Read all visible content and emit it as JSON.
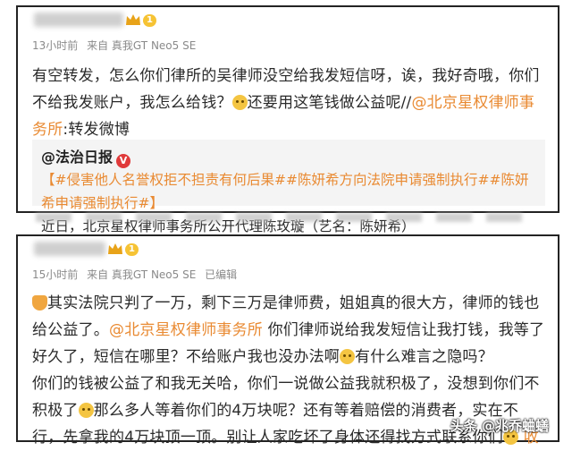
{
  "post1": {
    "level": "1",
    "meta": {
      "time": "13小时前",
      "source": "来自 真我GT Neo5 SE"
    },
    "text_a": "有空转发，怎么你们律所的吴律师没空给我发短信呀，诶，我好奇哦，你们不给我发账户，我怎么给钱？",
    "text_b": "还要用这笔钱做公益呢//",
    "mention": "@北京星权律师事务所",
    "text_c": ":转发微博",
    "quote": {
      "author": "@法治日报",
      "verified": "V",
      "tags": "【#侵害他人名誉权拒不担责有何后果##陈妍希方向法院申请强制执行##陈妍希申请强制执行#】",
      "body": "近日，北京星权律师事务所公开代理陈玫璇（艺名：陈妍希）"
    }
  },
  "post2": {
    "level": "1",
    "meta": {
      "time": "15小时前",
      "source": "来自 真我GT Neo5 SE",
      "edited": "已编辑"
    },
    "text_a": "其实法院只判了一万，剩下三万是律师费，姐姐真的很大方，律师的钱也给公益了。",
    "mention": "@北京星权律师事务所",
    "text_b": " 你们律师说给我发短信让我打钱，我等了好久了，短信在哪里？不给账户我也没办法啊",
    "text_c": "有什么难言之隐吗？",
    "text_d": "你们的钱被公益了和我无关哈，你们一说做公益我就积极了，没想到你们不积极了",
    "text_e": "那么多人等着你们的4万块呢？还有等着赔偿的消费者，实在不行，先拿我的4万块顶一顶。别让人家吃坏了身体还得找方式联系你们",
    "trail": "收"
  },
  "watermark": "头条 @兆乔蛐蟮"
}
